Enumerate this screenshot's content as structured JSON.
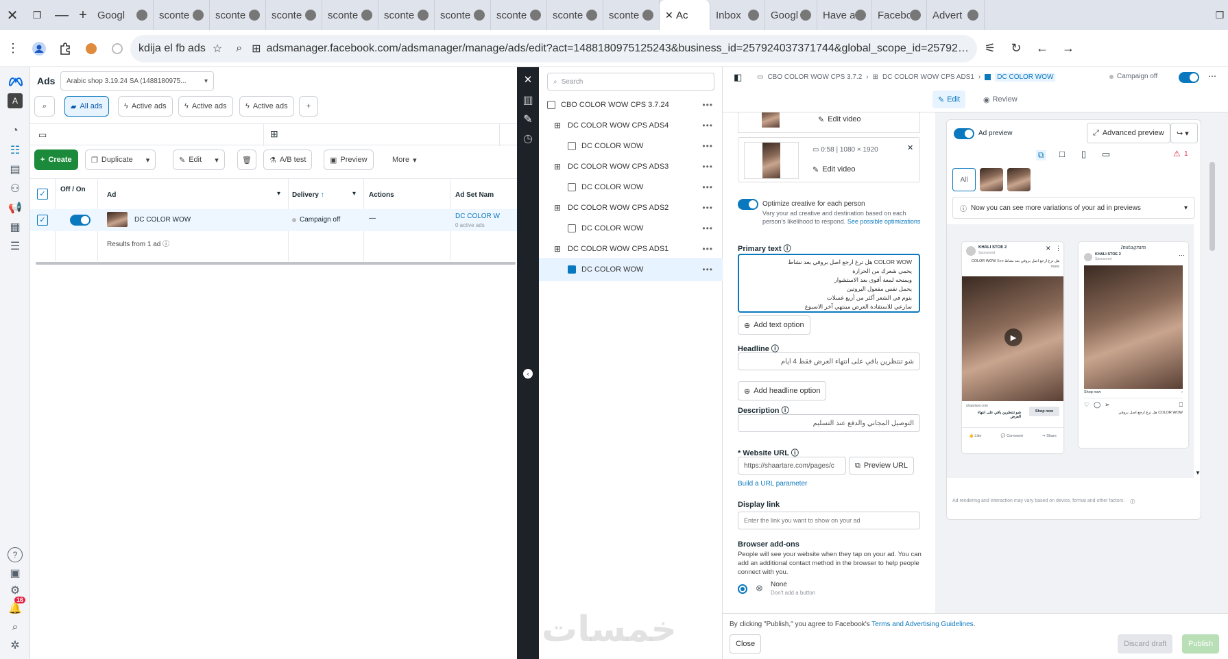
{
  "tabs": [
    {
      "label": "Googl",
      "active": false
    },
    {
      "label": "sconte",
      "active": false
    },
    {
      "label": "sconte",
      "active": false
    },
    {
      "label": "sconte",
      "active": false
    },
    {
      "label": "sconte",
      "active": false
    },
    {
      "label": "sconte",
      "active": false
    },
    {
      "label": "sconte",
      "active": false
    },
    {
      "label": "sconte",
      "active": false
    },
    {
      "label": "sconte",
      "active": false
    },
    {
      "label": "sconte",
      "active": false
    },
    {
      "label": "Ac",
      "active": true
    },
    {
      "label": "Inbox",
      "active": false
    },
    {
      "label": "Googl",
      "active": false
    },
    {
      "label": "Have a",
      "active": false
    },
    {
      "label": "Facebo",
      "active": false
    },
    {
      "label": "Advert",
      "active": false
    }
  ],
  "address": {
    "profile_label": "kdija el fb ads",
    "url": "adsmanager.facebook.com/adsmanager/manage/ads/edit?act=1488180975125243&business_id=257924037371744&global_scope_id=257924037371744&nav_entry..."
  },
  "ads_panel": {
    "title": "Ads",
    "account": "Arabic shop 3.19.24 SA (1488180975...",
    "filters": [
      "All ads",
      "Active ads",
      "Active ads",
      "Active ads"
    ],
    "toolbar": {
      "create": "Create",
      "duplicate": "Duplicate",
      "edit": "Edit",
      "ab_test": "A/B test",
      "preview": "Preview",
      "more": "More"
    },
    "columns": {
      "off_on": "Off / On",
      "ad": "Ad",
      "delivery": "Delivery",
      "actions": "Actions",
      "ad_set": "Ad Set Nam"
    },
    "row": {
      "name": "DC COLOR WOW",
      "delivery": "Campaign off",
      "actions": "—",
      "ad_set": "DC COLOR W",
      "ad_set_sub": "0 active ads"
    },
    "results": "Results from 1 ad"
  },
  "tree": {
    "search_placeholder": "Search",
    "items": [
      {
        "label": "CBO COLOR WOW CPS 3.7.24",
        "level": 0,
        "type": "campaign",
        "selected": false
      },
      {
        "label": "DC COLOR WOW CPS ADS4",
        "level": 1,
        "type": "adset",
        "selected": false
      },
      {
        "label": "DC COLOR WOW",
        "level": 2,
        "type": "ad",
        "selected": false
      },
      {
        "label": "DC COLOR WOW CPS ADS3",
        "level": 1,
        "type": "adset",
        "selected": false
      },
      {
        "label": "DC COLOR WOW",
        "level": 2,
        "type": "ad",
        "selected": false
      },
      {
        "label": "DC COLOR WOW CPS ADS2",
        "level": 1,
        "type": "adset",
        "selected": false
      },
      {
        "label": "DC COLOR WOW",
        "level": 2,
        "type": "ad",
        "selected": false
      },
      {
        "label": "DC COLOR WOW CPS ADS1",
        "level": 1,
        "type": "adset",
        "selected": false
      },
      {
        "label": "DC COLOR WOW",
        "level": 2,
        "type": "ad",
        "selected": true
      }
    ]
  },
  "editor": {
    "breadcrumb": [
      "CBO COLOR WOW CPS 3.7.2",
      "DC COLOR WOW CPS ADS1",
      "DC COLOR WOW"
    ],
    "campaign_status": "Campaign off",
    "tabs": {
      "edit": "Edit",
      "review": "Review"
    },
    "media": {
      "edit_video": "Edit video",
      "video_meta": "0:58 | 1080 × 1920"
    },
    "optimize": {
      "title": "Optimize creative for each person",
      "desc": "Vary your ad creative and destination based on each person's likelihood to respond.",
      "link": "See possible optimizations"
    },
    "primary_text": {
      "label": "Primary text",
      "lines": [
        "COLOR WOW هل ترغ ارجع اصل بروفي بعد نشاط",
        "يحمي شعرك من الحرارة",
        "ويمنحه لمعة أقوى بعد الاستشوار",
        "يحمل نفس مفعول البروتين",
        "ينوم في الشعر أكثر من أربع غسلات",
        "سارعي للاستفادة العرض مينتهي آخر الاسبوع"
      ]
    },
    "add_text_option": "Add text option",
    "headline": {
      "label": "Headline",
      "value": "شو تنتظرين باقي على انتهاء العرض فقط 4 ايام"
    },
    "add_headline_option": "Add headline option",
    "description": {
      "label": "Description",
      "value": "التوصيل المجاني والدفع عند التسليم"
    },
    "website_url": {
      "label": "* Website URL",
      "value": "https://shaartare.com/pages/c",
      "preview": "Preview URL"
    },
    "url_param": "Build a URL parameter",
    "display_link": {
      "label": "Display link",
      "placeholder": "Enter the link you want to show on your ad"
    },
    "browser_addons": {
      "label": "Browser add-ons",
      "desc": "People will see your website when they tap on your ad. You can add an additional contact method in the browser to help people connect with you.",
      "none": "None",
      "none_sub": "Don't add a button"
    },
    "terms": {
      "prefix": "By clicking \"Publish,\" you agree to Facebook's ",
      "link": "Terms and Advertising Guidelines",
      "suffix": "."
    },
    "close": "Close",
    "discard": "Discard draft",
    "publish": "Publish"
  },
  "preview": {
    "ad_preview": "Ad preview",
    "advanced_preview": "Advanced preview",
    "all": "All",
    "notice": "Now you can see more variations of your ad in previews",
    "fb_card": {
      "page": "KHALI STOE 2",
      "sponsored": "Sponsored",
      "text": "هل ترغ ارجع اصل بروفي بعد نشاط COLOR WOW",
      "more": "See more",
      "domain": "shaartare.com",
      "headline": "شو تنتظرين باقي على انتهاء العرض",
      "cta": "Shop now",
      "like": "Like",
      "comment": "Comment",
      "share": "Share"
    },
    "ig_card": {
      "brand": "Instagram",
      "page": "KHALI STOE 2",
      "sponsored": "Sponsored",
      "cta": "Shop now",
      "caption": "COLOR WOW هل ترغ ارجع اصل بروفي"
    },
    "disclaimer": "Ad rendering and interaction may vary based on device, format and other factors."
  },
  "notifications": {
    "count": "16"
  },
  "watermark": "خمسات",
  "colors": {
    "accent": "#0a78be",
    "create_green": "#1b8a3a",
    "dark_bar": "#1d2229"
  }
}
